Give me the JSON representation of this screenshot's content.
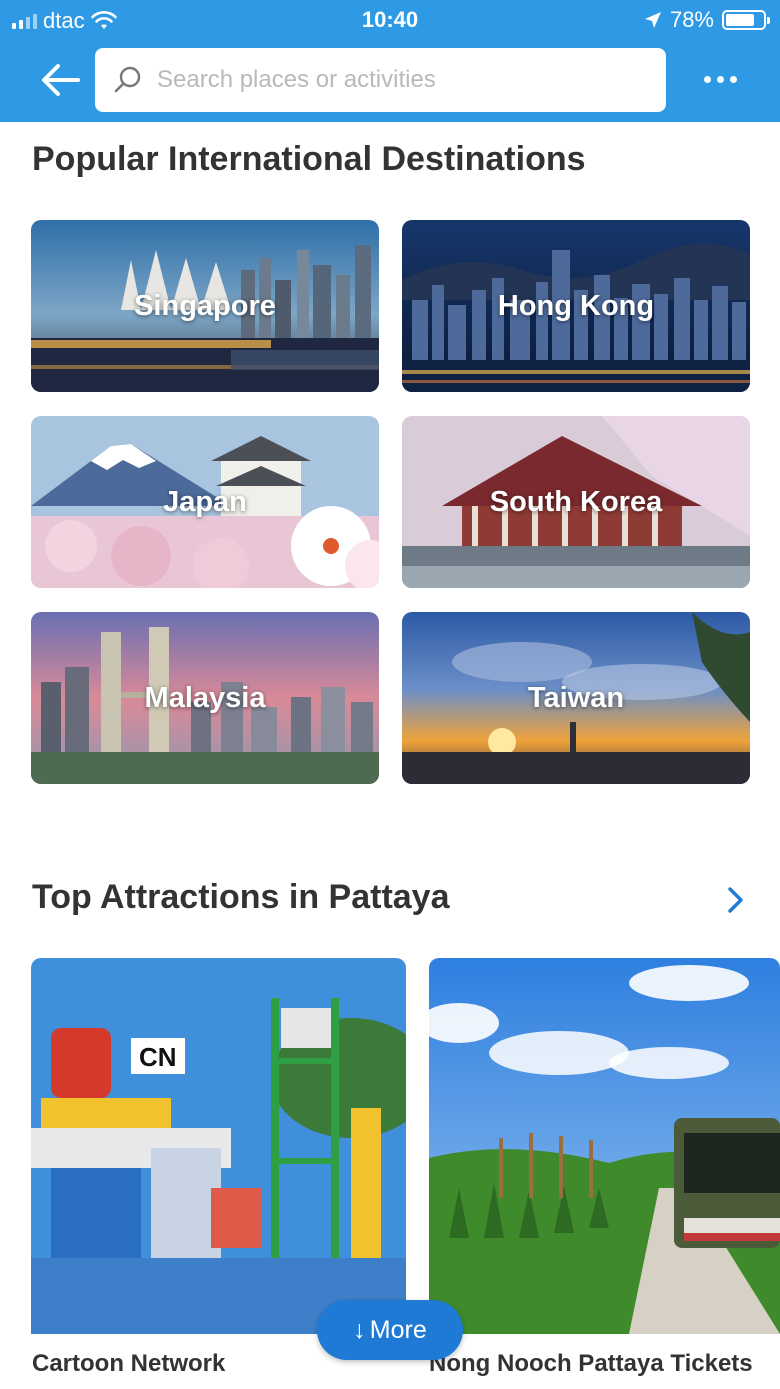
{
  "status": {
    "carrier": "dtac",
    "time": "10:40",
    "battery": "78%",
    "battery_level": 0.78
  },
  "header": {
    "search_placeholder": "Search places or activities"
  },
  "section_destinations": {
    "title": "Popular International Destinations",
    "items": [
      {
        "label": "Singapore"
      },
      {
        "label": "Hong Kong"
      },
      {
        "label": "Japan"
      },
      {
        "label": "South Korea"
      },
      {
        "label": "Malaysia"
      },
      {
        "label": "Taiwan"
      }
    ]
  },
  "section_attractions": {
    "title": "Top Attractions in Pattaya",
    "items": [
      {
        "name": "Cartoon Network"
      },
      {
        "name": "Nong Nooch Pattaya Tickets"
      }
    ]
  },
  "more_button": {
    "label": "More",
    "arrow": "↓"
  },
  "colors": {
    "header_bg": "#2e9ae6",
    "more_button_bg": "#1f7ad6",
    "chevron": "#1f7ad6"
  },
  "icons": {
    "back": "back-arrow-icon",
    "search": "search-icon",
    "more": "more-dots-icon",
    "chevron": "chevron-right-icon"
  }
}
